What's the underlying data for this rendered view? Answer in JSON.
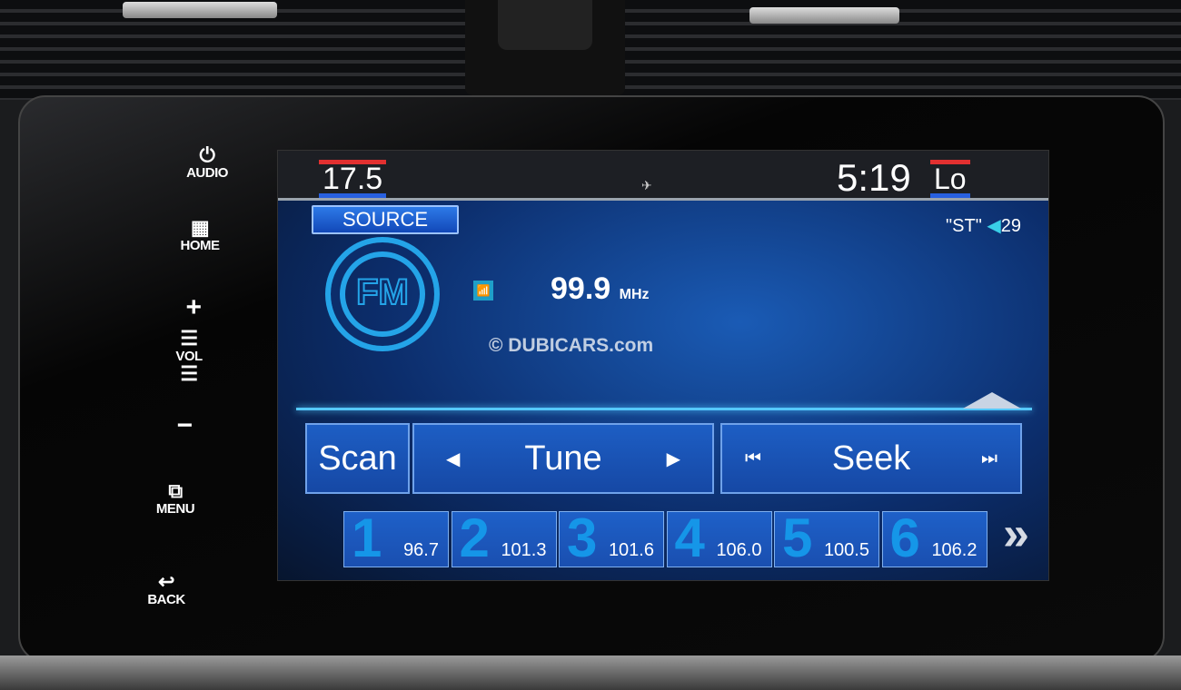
{
  "side_buttons": [
    {
      "label": "AUDIO",
      "icon": "power-icon",
      "glyph": "⏻"
    },
    {
      "label": "HOME",
      "icon": "grid-icon",
      "glyph": "▦"
    },
    {
      "label": "+",
      "icon": "plus-icon"
    },
    {
      "label": "VOL",
      "icon": "volume-bars-icon",
      "glyph": "☰"
    },
    {
      "label": "−",
      "icon": "minus-icon"
    },
    {
      "label": "MENU",
      "icon": "menu-icon",
      "glyph": "⧉"
    },
    {
      "label": "BACK",
      "icon": "back-arrow-icon",
      "glyph": "↩"
    }
  ],
  "status": {
    "driver_temp": "17.5",
    "clock": "5:19",
    "passenger_temp": "Lo",
    "gps_icon": "satellite-icon"
  },
  "radio": {
    "source_label": "SOURCE",
    "stereo": "\"ST\"",
    "volume": "29",
    "band": "FM",
    "frequency": "99.9",
    "unit": "MHz"
  },
  "watermark": "© DUBICARS.com",
  "controls": {
    "scan": "Scan",
    "tune": "Tune",
    "seek": "Seek"
  },
  "presets": [
    {
      "num": "1",
      "freq": "96.7"
    },
    {
      "num": "2",
      "freq": "101.3"
    },
    {
      "num": "3",
      "freq": "101.6"
    },
    {
      "num": "4",
      "freq": "106.0"
    },
    {
      "num": "5",
      "freq": "100.5"
    },
    {
      "num": "6",
      "freq": "106.2"
    }
  ],
  "colors": {
    "accent": "#1d5ec4",
    "temp_hot": "#e23030",
    "temp_cold": "#2860e0"
  }
}
